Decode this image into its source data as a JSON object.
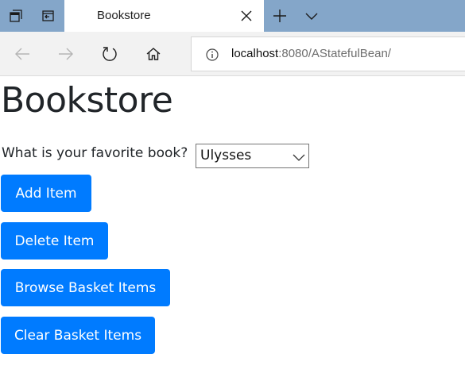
{
  "browser": {
    "tab": {
      "title": "Bookstore",
      "close_icon": "close-icon"
    },
    "tabstrip_icons": [
      "tab-preview-icon",
      "set-tabs-aside-icon",
      "new-tab-icon",
      "tab-list-chevron-icon"
    ],
    "nav_icons": [
      "back-icon",
      "forward-icon",
      "refresh-icon",
      "home-icon"
    ],
    "address": {
      "host": "localhost",
      "rest": ":8080/AStatefulBean/",
      "icon": "info-icon"
    },
    "colors": {
      "tabstrip": "#84a6c9",
      "navbar": "#f2f2f2"
    }
  },
  "page": {
    "heading": "Bookstore",
    "question": "What is your favorite book?",
    "book_select": {
      "selected": "Ulysses"
    },
    "buttons": {
      "add": "Add Item",
      "delete": "Delete Item",
      "browse": "Browse Basket Items",
      "clear": "Clear Basket Items"
    },
    "colors": {
      "button": "#007bff",
      "text": "#212529"
    }
  }
}
